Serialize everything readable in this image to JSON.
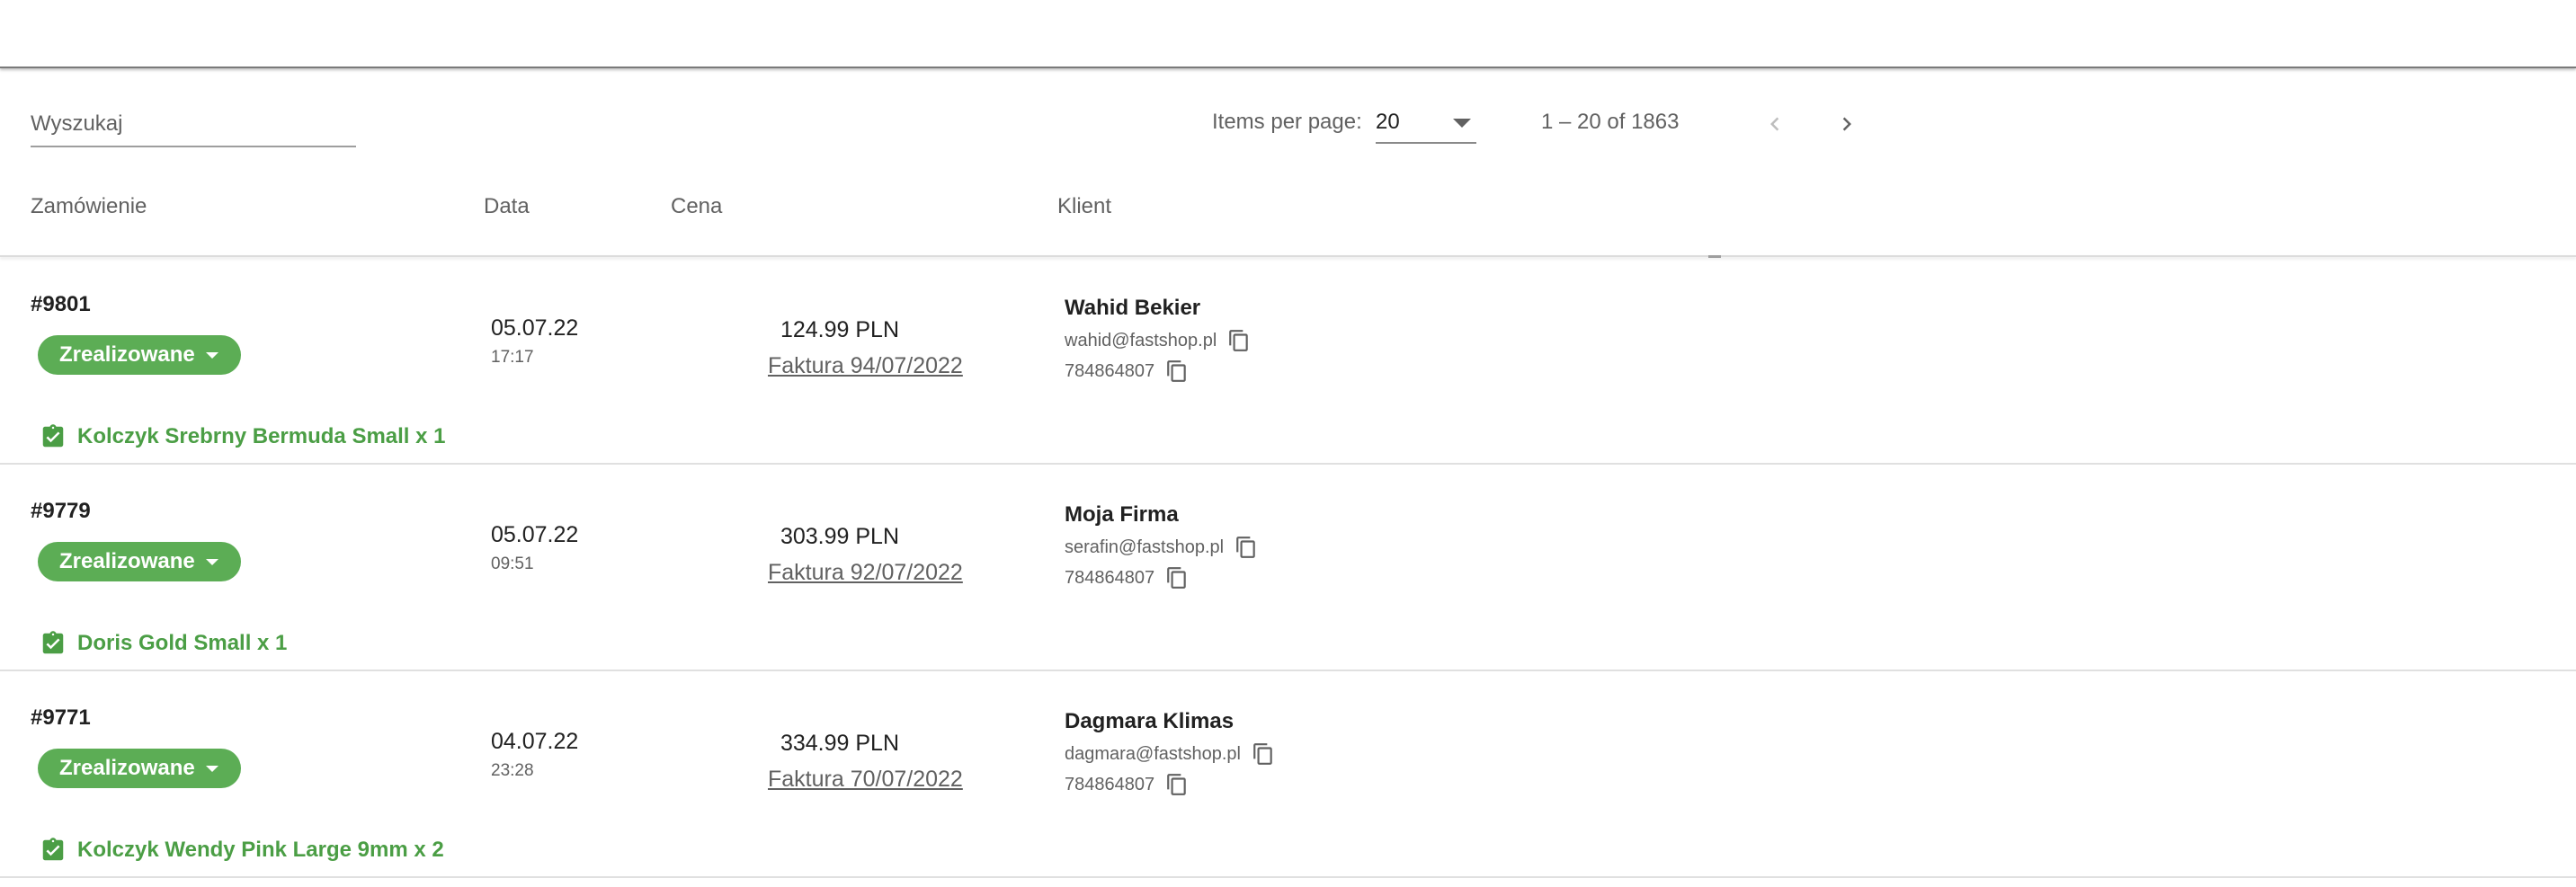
{
  "search": {
    "placeholder": "Wyszukaj"
  },
  "paginator": {
    "items_per_page_label": "Items per page:",
    "items_per_page_value": "20",
    "range_label": "1 – 20 of 1863"
  },
  "columns": {
    "order": "Zamówienie",
    "date": "Data",
    "price": "Cena",
    "client": "Klient"
  },
  "orders": [
    {
      "id": "#9801",
      "status": "Zrealizowane",
      "date": "05.07.22",
      "time": "17:17",
      "price": "124.99 PLN",
      "invoice": "Faktura 94/07/2022",
      "client_name": "Wahid Bekier",
      "client_email": "wahid@fastshop.pl",
      "client_phone": "784864807",
      "product": "Kolczyk Srebrny Bermuda Small x 1"
    },
    {
      "id": "#9779",
      "status": "Zrealizowane",
      "date": "05.07.22",
      "time": "09:51",
      "price": "303.99 PLN",
      "invoice": "Faktura 92/07/2022",
      "client_name": "Moja Firma",
      "client_email": "serafin@fastshop.pl",
      "client_phone": "784864807",
      "product": "Doris Gold Small x 1"
    },
    {
      "id": "#9771",
      "status": "Zrealizowane",
      "date": "04.07.22",
      "time": "23:28",
      "price": "334.99 PLN",
      "invoice": "Faktura 70/07/2022",
      "client_name": "Dagmara Klimas",
      "client_email": "dagmara@fastshop.pl",
      "client_phone": "784864807",
      "product": "Kolczyk Wendy Pink Large 9mm x 2"
    }
  ],
  "colors": {
    "status_chip": "#5cad55",
    "product_text": "#4b9e45",
    "muted_text": "#616161"
  },
  "icons": {
    "copy": "copy-icon",
    "product": "clipboard-check-icon",
    "prev": "chevron-left-icon",
    "next": "chevron-right-icon"
  }
}
